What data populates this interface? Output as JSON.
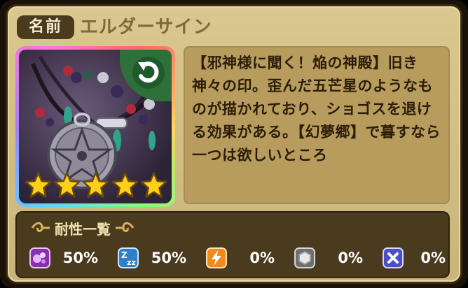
{
  "name_label": "名前",
  "item_name": "エルダーサイン",
  "description": "【邪神様に聞く！焔の神殿】旧き神々の印。歪んだ五芒星のようなものが描かれており、ショゴスを退ける効果がある。【幻夢郷】で暮すなら一つは欲しいところ",
  "star_count": 5,
  "resistance": {
    "title": "耐性一覧",
    "items": [
      {
        "icon": "poison-icon",
        "value": "50%"
      },
      {
        "icon": "sleep-icon",
        "value": "50%"
      },
      {
        "icon": "lightning-icon",
        "value": "0%"
      },
      {
        "icon": "hexagon-icon",
        "value": "0%"
      },
      {
        "icon": "cross-icon",
        "value": "0%"
      }
    ]
  },
  "colors": {
    "panel": "#d2bf84",
    "dark_box": "#4a3b1e",
    "text_dark": "#2b1d08",
    "star": "#ffd01a"
  }
}
